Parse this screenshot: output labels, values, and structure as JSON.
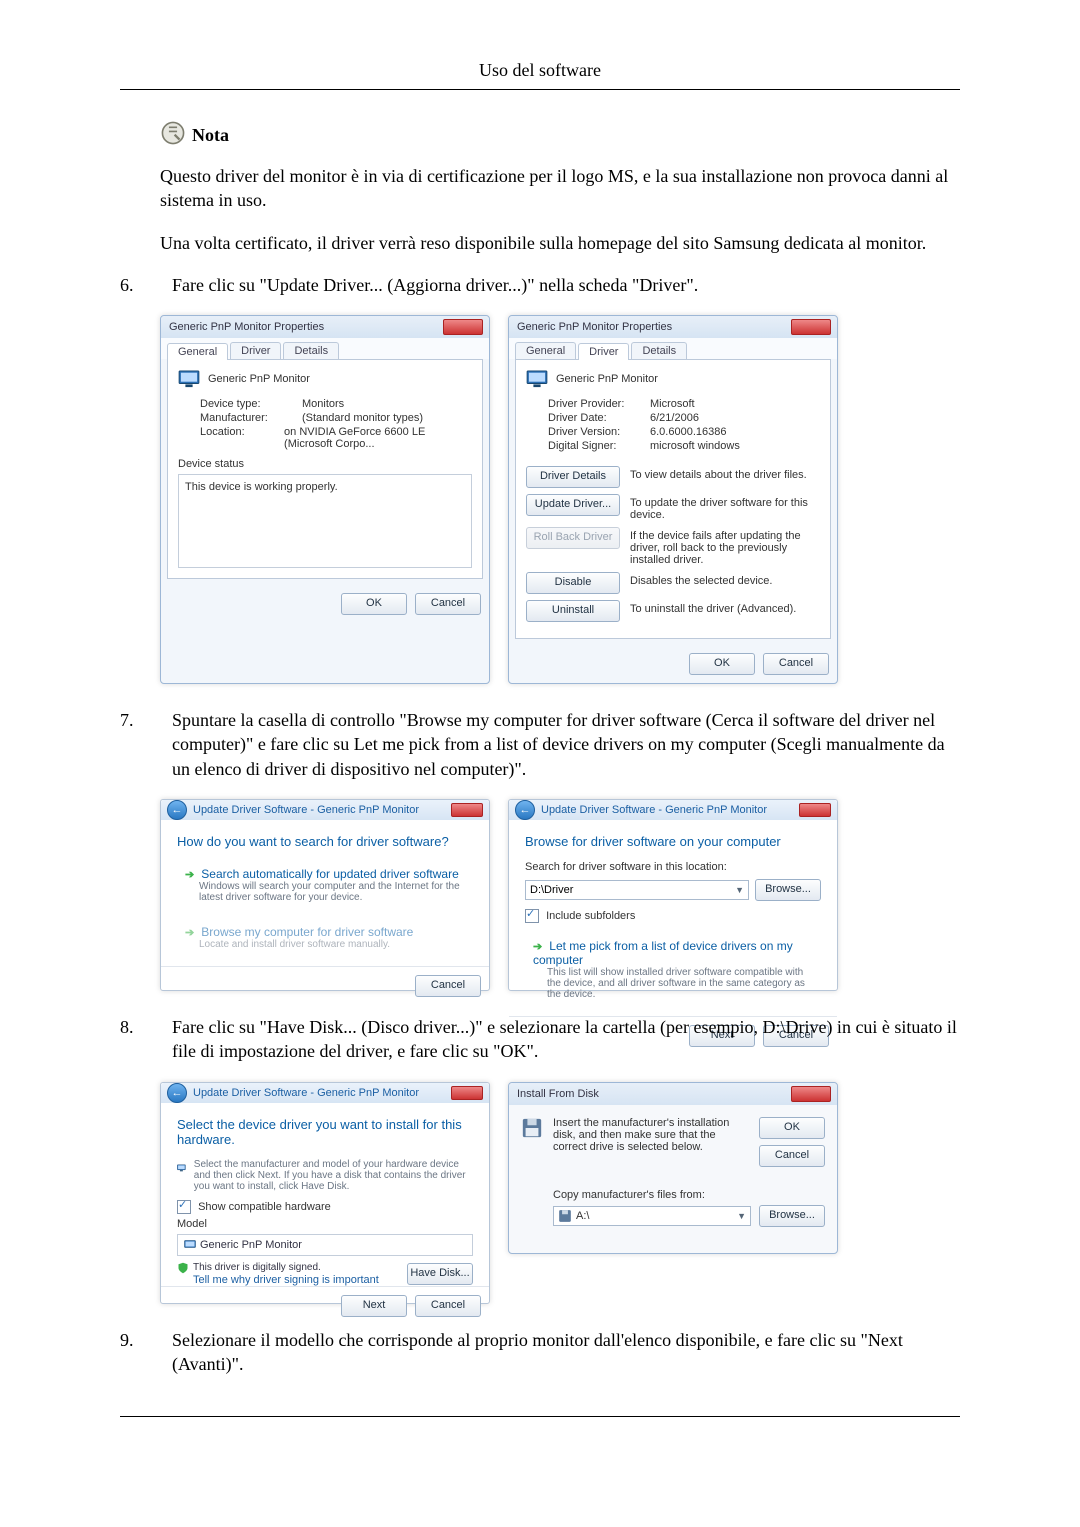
{
  "page_title": "Uso del software",
  "note": {
    "label": "Nota",
    "para1": "Questo driver del monitor è in via di certificazione per il logo MS, e la sua installazione non provoca danni al sistema in uso.",
    "para2": "Una volta certificato, il driver verrà reso disponibile sulla homepage del sito Samsung dedicata al monitor."
  },
  "steps": {
    "6": {
      "num": "6.",
      "text": "Fare clic su \"Update Driver... (Aggiorna driver...)\" nella scheda \"Driver\"."
    },
    "7": {
      "num": "7.",
      "text": "Spuntare la casella di controllo \"Browse my computer for driver software (Cerca il software del driver nel computer)\" e fare clic su Let me pick from a list of device drivers on my computer (Scegli manualmente da un elenco di driver di dispositivo nel computer)\"."
    },
    "8": {
      "num": "8.",
      "text": "Fare clic su \"Have Disk... (Disco driver...)\" e selezionare la cartella (per esempio, D:\\Drive) in cui è situato il file di impostazione del driver, e fare clic su \"OK\"."
    },
    "9": {
      "num": "9.",
      "text": "Selezionare il modello che corrisponde al proprio monitor dall'elenco disponibile, e fare clic su \"Next (Avanti)\"."
    }
  },
  "dlg_props": {
    "title": "Generic PnP Monitor Properties",
    "tabs": {
      "general": "General",
      "driver": "Driver",
      "details": "Details"
    },
    "devname": "Generic PnP Monitor",
    "general": {
      "device_type_k": "Device type:",
      "device_type_v": "Monitors",
      "manufacturer_k": "Manufacturer:",
      "manufacturer_v": "(Standard monitor types)",
      "location_k": "Location:",
      "location_v": "on NVIDIA GeForce 6600 LE (Microsoft Corpo...",
      "status_label": "Device status",
      "status_text": "This device is working properly."
    },
    "driver": {
      "provider_k": "Driver Provider:",
      "provider_v": "Microsoft",
      "date_k": "Driver Date:",
      "date_v": "6/21/2006",
      "version_k": "Driver Version:",
      "version_v": "6.0.6000.16386",
      "signer_k": "Digital Signer:",
      "signer_v": "microsoft windows",
      "btn_details": "Driver Details",
      "btn_details_desc": "To view details about the driver files.",
      "btn_update": "Update Driver...",
      "btn_update_desc": "To update the driver software for this device.",
      "btn_rollback": "Roll Back Driver",
      "btn_rollback_desc": "If the device fails after updating the driver, roll back to the previously installed driver.",
      "btn_disable": "Disable",
      "btn_disable_desc": "Disables the selected device.",
      "btn_uninstall": "Uninstall",
      "btn_uninstall_desc": "To uninstall the driver (Advanced)."
    },
    "ok": "OK",
    "cancel": "Cancel"
  },
  "wiz_update": {
    "crumb": "Update Driver Software - Generic PnP Monitor",
    "heading": "How do you want to search for driver software?",
    "opt1_title": "Search automatically for updated driver software",
    "opt1_sub": "Windows will search your computer and the Internet for the latest driver software for your device.",
    "opt2_title": "Browse my computer for driver software",
    "opt2_sub": "Locate and install driver software manually.",
    "cancel": "Cancel"
  },
  "wiz_browse": {
    "crumb": "Update Driver Software - Generic PnP Monitor",
    "heading": "Browse for driver software on your computer",
    "path_label": "Search for driver software in this location:",
    "path_value": "D:\\Driver",
    "browse": "Browse...",
    "include": "Include subfolders",
    "pick_title": "Let me pick from a list of device drivers on my computer",
    "pick_sub": "This list will show installed driver software compatible with the device, and all driver software in the same category as the device.",
    "next": "Next",
    "cancel": "Cancel"
  },
  "wiz_select": {
    "crumb": "Update Driver Software - Generic PnP Monitor",
    "heading": "Select the device driver you want to install for this hardware.",
    "sub": "Select the manufacturer and model of your hardware device and then click Next. If you have a disk that contains the driver you want to install, click Have Disk.",
    "compat": "Show compatible hardware",
    "col_model": "Model",
    "item": "Generic PnP Monitor",
    "signed": "This driver is digitally signed.",
    "tell": "Tell me why driver signing is important",
    "have_disk": "Have Disk...",
    "next": "Next",
    "cancel": "Cancel"
  },
  "dlg_install": {
    "title": "Install From Disk",
    "msg": "Insert the manufacturer's installation disk, and then make sure that the correct drive is selected below.",
    "copy": "Copy manufacturer's files from:",
    "path": "A:\\",
    "ok": "OK",
    "cancel": "Cancel",
    "browse": "Browse..."
  }
}
